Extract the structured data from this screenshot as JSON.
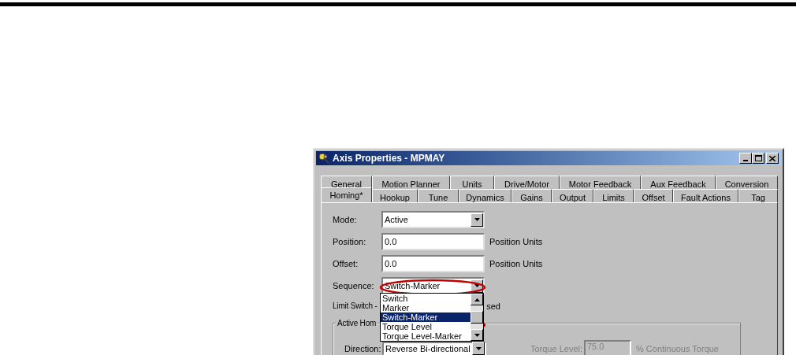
{
  "window": {
    "title": "Axis Properties - MPMAY"
  },
  "tab_rows": [
    [
      {
        "label": "General",
        "selected": false
      },
      {
        "label": "Motion Planner",
        "selected": false
      },
      {
        "label": "Units",
        "selected": false
      },
      {
        "label": "Drive/Motor",
        "selected": false
      },
      {
        "label": "Motor Feedback",
        "selected": false
      },
      {
        "label": "Aux Feedback",
        "selected": false
      },
      {
        "label": "Conversion",
        "selected": false
      }
    ],
    [
      {
        "label": "Homing*",
        "selected": true
      },
      {
        "label": "Hookup",
        "selected": false
      },
      {
        "label": "Tune",
        "selected": false
      },
      {
        "label": "Dynamics",
        "selected": false
      },
      {
        "label": "Gains",
        "selected": false
      },
      {
        "label": "Output",
        "selected": false
      },
      {
        "label": "Limits",
        "selected": false
      },
      {
        "label": "Offset",
        "selected": false
      },
      {
        "label": "Fault Actions",
        "selected": false
      },
      {
        "label": "Tag",
        "selected": false
      }
    ]
  ],
  "fields": [
    {
      "kind": "combo",
      "label": "Mode:",
      "value": "Active"
    },
    {
      "kind": "text",
      "label": "Position:",
      "value": "0.0",
      "units": "Position Units"
    },
    {
      "kind": "text",
      "label": "Offset:",
      "value": "0.0",
      "units": "Position Units"
    },
    {
      "kind": "combo",
      "label": "Sequence:",
      "value": "Switch-Marker"
    }
  ],
  "limit_switch": {
    "label": "Limit Switch -",
    "tail": "sed"
  },
  "dropdown_list": {
    "items": [
      {
        "label": "Switch",
        "selected": false
      },
      {
        "label": "Marker",
        "selected": false
      },
      {
        "label": "Switch-Marker",
        "selected": true
      },
      {
        "label": "Torque Level",
        "selected": false
      },
      {
        "label": "Torque Level-Marker",
        "selected": false
      }
    ]
  },
  "group": {
    "legend": "Active Hom",
    "direction": {
      "label": "Direction:",
      "value": "Reverse Bi-directional"
    },
    "torque_level": {
      "label": "Torque Level:",
      "value": "75.0",
      "units": "% Continuous Torque",
      "disabled": true
    }
  }
}
